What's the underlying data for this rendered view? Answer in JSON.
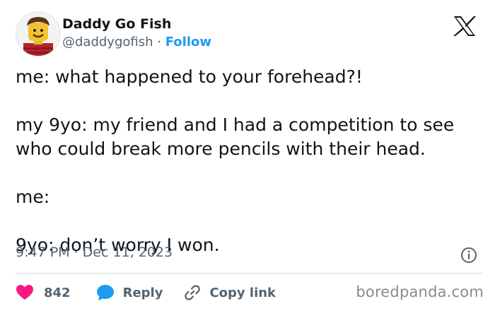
{
  "author": {
    "name": "Daddy Go Fish",
    "handle": "@daddygofish",
    "separator": "·",
    "follow_label": "Follow"
  },
  "tweet": {
    "lines": [
      "me: what happened to your forehead?!",
      "my 9yo: my friend and I had a competition to see who could break more pencils with their head.",
      "me:",
      "9yo: don’t worry I won."
    ],
    "timestamp": "9:47 PM · Dec 11, 2023"
  },
  "actions": {
    "like_count": "842",
    "reply_label": "Reply",
    "copy_link_label": "Copy link"
  },
  "watermark": "boredpanda.com",
  "colors": {
    "like": "#f91880",
    "reply": "#1d9bf0",
    "link": "#1d9bf0",
    "text": "#0f1419",
    "muted": "#536471"
  },
  "icons": [
    "avatar",
    "x-logo-icon",
    "info-icon",
    "heart-icon",
    "reply-bubble-icon",
    "link-icon"
  ]
}
